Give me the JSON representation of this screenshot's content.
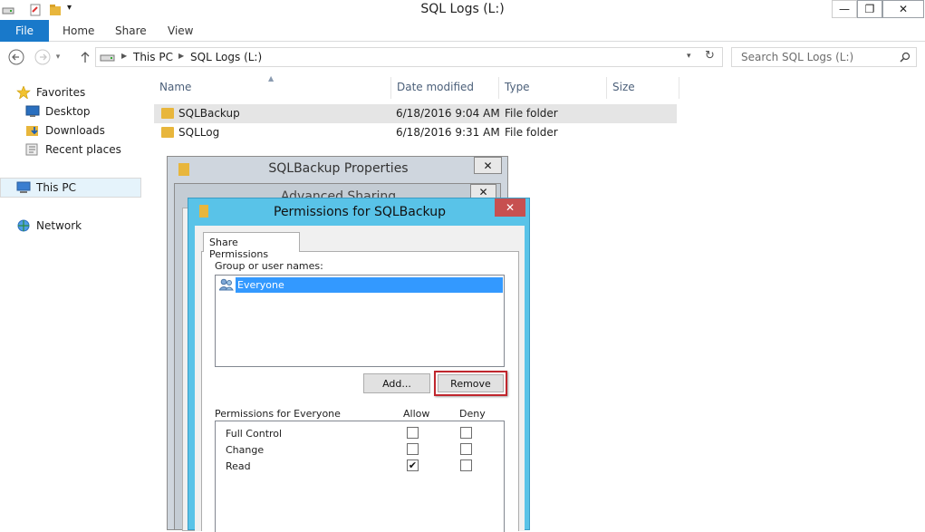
{
  "window": {
    "title": "SQL Logs (L:)",
    "minimize_glyph": "—",
    "restore_glyph": "❐",
    "close_glyph": "✕"
  },
  "ribbon": {
    "file": "File",
    "tabs": [
      "Home",
      "Share",
      "View"
    ]
  },
  "address": {
    "crumbs": [
      "This PC",
      "SQL Logs (L:)"
    ],
    "search_placeholder": "Search SQL Logs (L:)"
  },
  "nav": {
    "favorites": "Favorites",
    "desktop": "Desktop",
    "downloads": "Downloads",
    "recent": "Recent places",
    "this_pc": "This PC",
    "network": "Network"
  },
  "columns": {
    "name": "Name",
    "date": "Date modified",
    "type": "Type",
    "size": "Size"
  },
  "files": [
    {
      "name": "SQLBackup",
      "date": "6/18/2016 9:04 AM",
      "type": "File folder"
    },
    {
      "name": "SQLLog",
      "date": "6/18/2016 9:31 AM",
      "type": "File folder"
    }
  ],
  "dialogs": {
    "properties_title": "SQLBackup Properties",
    "advanced_title": "Advanced Sharing",
    "permissions_title": "Permissions for SQLBackup",
    "close_glyph": "✕"
  },
  "permissions": {
    "tab": "Share Permissions",
    "group_label": "Group or user names:",
    "users": [
      "Everyone"
    ],
    "add_button": "Add...",
    "remove_button": "Remove",
    "perm_label": "Permissions for Everyone",
    "allow_label": "Allow",
    "deny_label": "Deny",
    "rows": [
      {
        "name": "Full Control",
        "allow": "",
        "deny": ""
      },
      {
        "name": "Change",
        "allow": "",
        "deny": ""
      },
      {
        "name": "Read",
        "allow": "✔",
        "deny": ""
      }
    ]
  },
  "colors": {
    "accent": "#1979ca",
    "dialog_frame": "#59c3e8",
    "selection": "#3399ff",
    "highlight_border": "#c0262d",
    "close_red": "#c75050"
  }
}
